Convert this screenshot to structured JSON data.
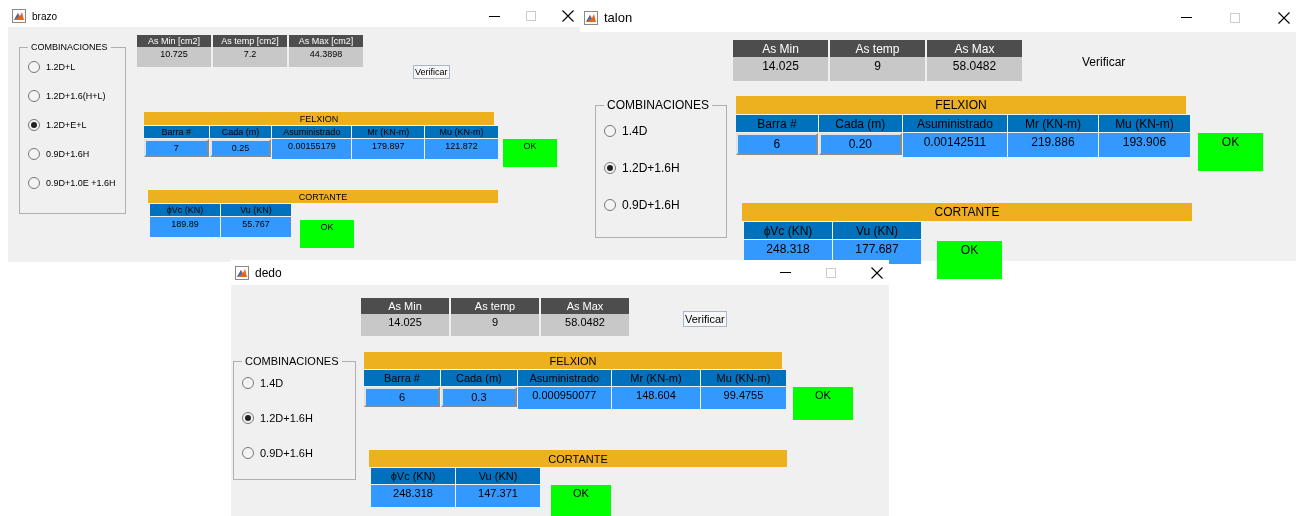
{
  "windows": [
    {
      "title": "brazo",
      "combinations": {
        "title": "COMBINACIONES",
        "options": [
          {
            "label": "1.2D+L",
            "selected": false
          },
          {
            "label": "1.2D+1.6(H+L)",
            "selected": false
          },
          {
            "label": "1.2D+E+L",
            "selected": true
          },
          {
            "label": "0.9D+1.6H",
            "selected": false
          },
          {
            "label": "0.9D+1.0E +1.6H",
            "selected": false
          }
        ]
      },
      "as_table": {
        "columns": [
          "As Min [cm2]",
          "As temp [cm2]",
          "As Max [cm2]"
        ],
        "values": [
          "10.725",
          "7.2",
          "44.3898"
        ]
      },
      "verify_button": {
        "label": "Verificar",
        "framed": true
      },
      "flexion": {
        "title": "FELXION",
        "cells": [
          {
            "header": "Barra #",
            "value": "7",
            "kind": "input"
          },
          {
            "header": "Cada (m)",
            "value": "0.25",
            "kind": "input"
          },
          {
            "header": "Asuministrado",
            "value": "0.00155179",
            "kind": "output"
          },
          {
            "header": "Mr (KN-m)",
            "value": "179.897",
            "kind": "output"
          },
          {
            "header": "Mu (KN-m)",
            "value": "121.872",
            "kind": "output"
          }
        ],
        "status": "OK"
      },
      "cortante": {
        "title": "CORTANTE",
        "cells": [
          {
            "header": "ϕVc (KN)",
            "value": "189.89"
          },
          {
            "header": "Vu (KN)",
            "value": "55.767"
          }
        ],
        "status": "OK"
      }
    },
    {
      "title": "talon",
      "combinations": {
        "title": "COMBINACIONES",
        "options": [
          {
            "label": "1.4D",
            "selected": false
          },
          {
            "label": "1.2D+1.6H",
            "selected": true
          },
          {
            "label": "0.9D+1.6H",
            "selected": false
          }
        ]
      },
      "as_table": {
        "columns": [
          "As Min",
          "As temp",
          "As Max"
        ],
        "values": [
          "14.025",
          "9",
          "58.0482"
        ]
      },
      "verify_button": {
        "label": "Verificar",
        "framed": false
      },
      "flexion": {
        "title": "FELXION",
        "cells": [
          {
            "header": "Barra #",
            "value": "6",
            "kind": "input"
          },
          {
            "header": "Cada (m)",
            "value": "0.20",
            "kind": "input"
          },
          {
            "header": "Asuministrado",
            "value": "0.00142511",
            "kind": "output"
          },
          {
            "header": "Mr (KN-m)",
            "value": "219.886",
            "kind": "output"
          },
          {
            "header": "Mu (KN-m)",
            "value": "193.906",
            "kind": "output"
          }
        ],
        "status": "OK"
      },
      "cortante": {
        "title": "CORTANTE",
        "cells": [
          {
            "header": "ϕVc (KN)",
            "value": "248.318"
          },
          {
            "header": "Vu (KN)",
            "value": "177.687"
          }
        ],
        "status": "OK"
      }
    },
    {
      "title": "dedo",
      "combinations": {
        "title": "COMBINACIONES",
        "options": [
          {
            "label": "1.4D",
            "selected": false
          },
          {
            "label": "1.2D+1.6H",
            "selected": true
          },
          {
            "label": "0.9D+1.6H",
            "selected": false
          }
        ]
      },
      "as_table": {
        "columns": [
          "As Min",
          "As temp",
          "As Max"
        ],
        "values": [
          "14.025",
          "9",
          "58.0482"
        ]
      },
      "verify_button": {
        "label": "Verificar",
        "framed": true
      },
      "flexion": {
        "title": "FELXION",
        "cells": [
          {
            "header": "Barra #",
            "value": "6",
            "kind": "input"
          },
          {
            "header": "Cada (m)",
            "value": "0.3",
            "kind": "input"
          },
          {
            "header": "Asuministrado",
            "value": "0.000950077",
            "kind": "output"
          },
          {
            "header": "Mr (KN-m)",
            "value": "148.604",
            "kind": "output"
          },
          {
            "header": "Mu (KN-m)",
            "value": "99.4755",
            "kind": "output"
          }
        ],
        "status": "OK"
      },
      "cortante": {
        "title": "CORTANTE",
        "cells": [
          {
            "header": "ϕVc (KN)",
            "value": "248.318"
          },
          {
            "header": "Vu (KN)",
            "value": "147.371"
          }
        ],
        "status": "OK"
      }
    }
  ]
}
